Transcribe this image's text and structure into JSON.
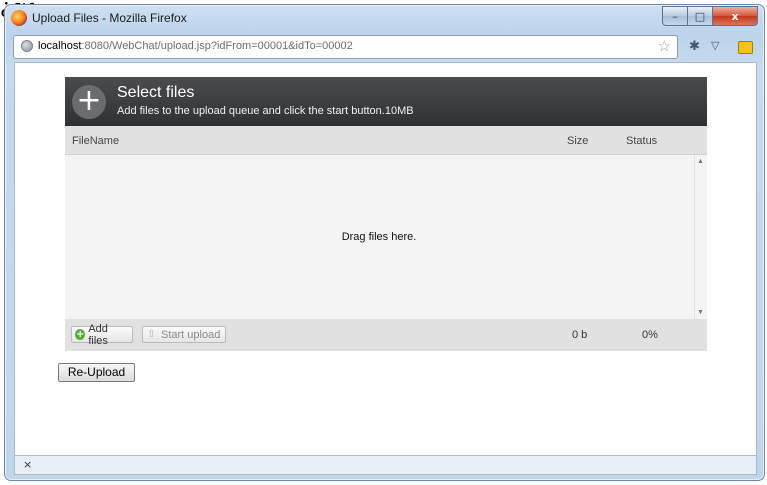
{
  "window": {
    "title": "Upload Files - Mozilla Firefox",
    "controls": {
      "minimize": "–",
      "maximize": "□",
      "close": "x"
    }
  },
  "address_bar": {
    "url_host": "localhost",
    "url_rest": ":8080/WebChat/upload.jsp?idFrom=00001&idTo=00002"
  },
  "toolbar_icons": [
    "globe-icon",
    "star-icon",
    "puzzle-icon",
    "menu-chevron-icon",
    "rss-icon"
  ],
  "uploader": {
    "header_title": "Select files",
    "header_subtitle": "Add files to the upload queue and click the start button.10MB",
    "columns": {
      "filename": "FileName",
      "size": "Size",
      "status": "Status"
    },
    "drop_text": "Drag files here.",
    "add_files_label": "Add files",
    "start_upload_label": "Start upload",
    "total_size": "0 b",
    "total_status": "0%"
  },
  "reupload_label": "Re-Upload",
  "statusbar": {
    "close": "×"
  },
  "colors": {
    "header_bg": "#3a3c3f",
    "panel_bg": "#e1e1e1",
    "drop_bg": "#f4f4f4",
    "add_icon": "#5aa93a"
  }
}
